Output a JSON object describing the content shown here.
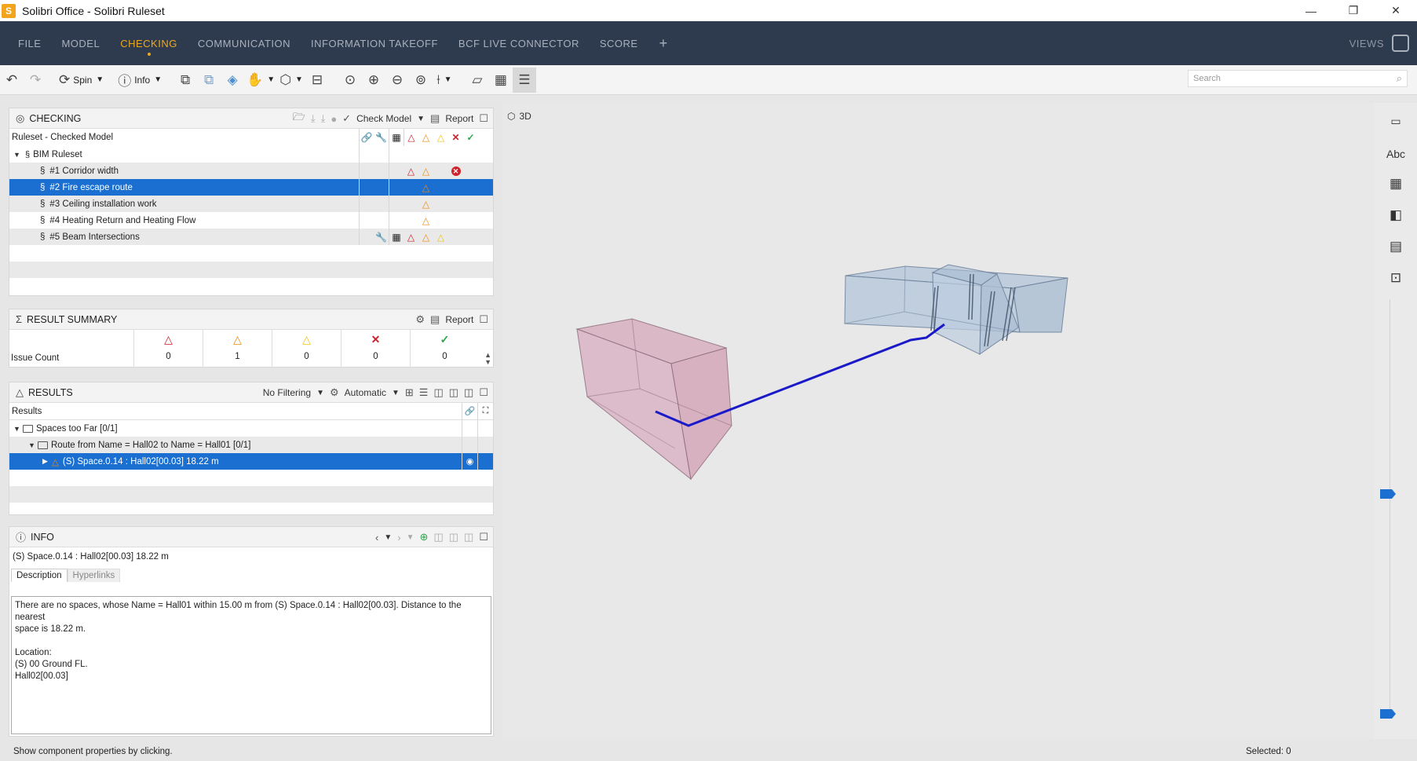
{
  "window": {
    "title": "Solibri Office - Solibri Ruleset",
    "logo_letter": "S",
    "minimize": "—",
    "maximize": "❐",
    "close": "✕"
  },
  "menu": {
    "items": [
      "FILE",
      "MODEL",
      "CHECKING",
      "COMMUNICATION",
      "INFORMATION TAKEOFF",
      "BCF LIVE CONNECTOR",
      "SCORE"
    ],
    "active": "CHECKING",
    "plus": "+",
    "views": "VIEWS"
  },
  "toolbar": {
    "spin_label": "Spin",
    "info_label": "Info",
    "search_placeholder": "Search"
  },
  "checking": {
    "title": "CHECKING",
    "check_model_label": "Check Model",
    "report_label": "Report",
    "header_label": "Ruleset - Checked Model",
    "root_label": "BIM Ruleset",
    "rules": [
      {
        "label": "#1 Corridor width"
      },
      {
        "label": "#2 Fire escape route"
      },
      {
        "label": "#3 Ceiling installation work"
      },
      {
        "label": "#4 Heating Return and Heating Flow"
      },
      {
        "label": "#5 Beam Intersections"
      }
    ]
  },
  "summary": {
    "title": "RESULT SUMMARY",
    "report_label": "Report",
    "row_label": "Issue Count",
    "counts": [
      "0",
      "1",
      "0",
      "0",
      "0"
    ]
  },
  "results": {
    "title": "RESULTS",
    "filter_label": "No Filtering",
    "mode_label": "Automatic",
    "column_label": "Results",
    "rows": [
      {
        "label": "Spaces too Far [0/1]"
      },
      {
        "label": "Route from Name = Hall02 to Name = Hall01 [0/1]"
      },
      {
        "label": "(S) Space.0.14 : Hall02[00.03] 18.22 m"
      }
    ]
  },
  "info": {
    "title": "INFO",
    "subject": "(S) Space.0.14 : Hall02[00.03] 18.22 m",
    "tab_description": "Description",
    "tab_hyperlinks": "Hyperlinks",
    "description": "There are no spaces, whose Name = Hall01 within 15.00 m from (S) Space.0.14 : Hall02[00.03]. Distance to the nearest\nspace is 18.22 m.\n\nLocation:\n(S) 00 Ground FL.\nHall02[00.03]"
  },
  "view3d": {
    "label": "3D"
  },
  "rightbar": {
    "abc_label": "Abc"
  },
  "status": {
    "hint": "Show component properties by clicking.",
    "selected": "Selected: 0"
  },
  "colors": {
    "menubar": "#2e3a4e",
    "accent": "#f0a81c",
    "selection": "#1a6fd1",
    "critical": "#d0202a",
    "moderate": "#f08a10",
    "low": "#f2c41a",
    "passed": "#2aa84a",
    "route": "#1a1ac8"
  }
}
